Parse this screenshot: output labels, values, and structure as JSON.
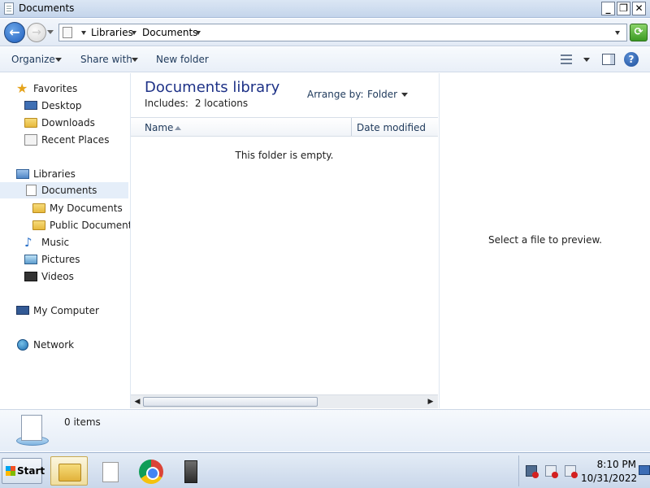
{
  "window": {
    "title": "Documents",
    "controls": {
      "minimize": "_",
      "maximize": "❐",
      "close": "✕"
    }
  },
  "address_bar": {
    "breadcrumbs": [
      "Libraries",
      "Documents"
    ]
  },
  "toolbar": {
    "organize": "Organize",
    "share_with": "Share with",
    "new_folder": "New folder"
  },
  "nav": {
    "favorites": {
      "label": "Favorites",
      "items": [
        "Desktop",
        "Downloads",
        "Recent Places"
      ]
    },
    "libraries": {
      "label": "Libraries",
      "documents": "Documents",
      "my_documents": "My Documents",
      "public_documents": "Public Documents",
      "music": "Music",
      "pictures": "Pictures",
      "videos": "Videos"
    },
    "computer": "My Computer",
    "network": "Network"
  },
  "content": {
    "title": "Documents library",
    "includes_label": "Includes:",
    "includes_value": "2 locations",
    "arrange_by_label": "Arrange by:",
    "arrange_by_value": "Folder",
    "columns": {
      "name": "Name",
      "date_modified": "Date modified"
    },
    "empty_message": "This folder is empty."
  },
  "preview": {
    "message": "Select a file to preview."
  },
  "details": {
    "item_count": "0 items"
  },
  "taskbar": {
    "start_label": "Start",
    "apps": [
      "file-explorer-icon",
      "file-icon",
      "chrome-icon",
      "server-icon"
    ],
    "clock_time": "8:10 PM",
    "clock_date": "10/31/2022"
  }
}
